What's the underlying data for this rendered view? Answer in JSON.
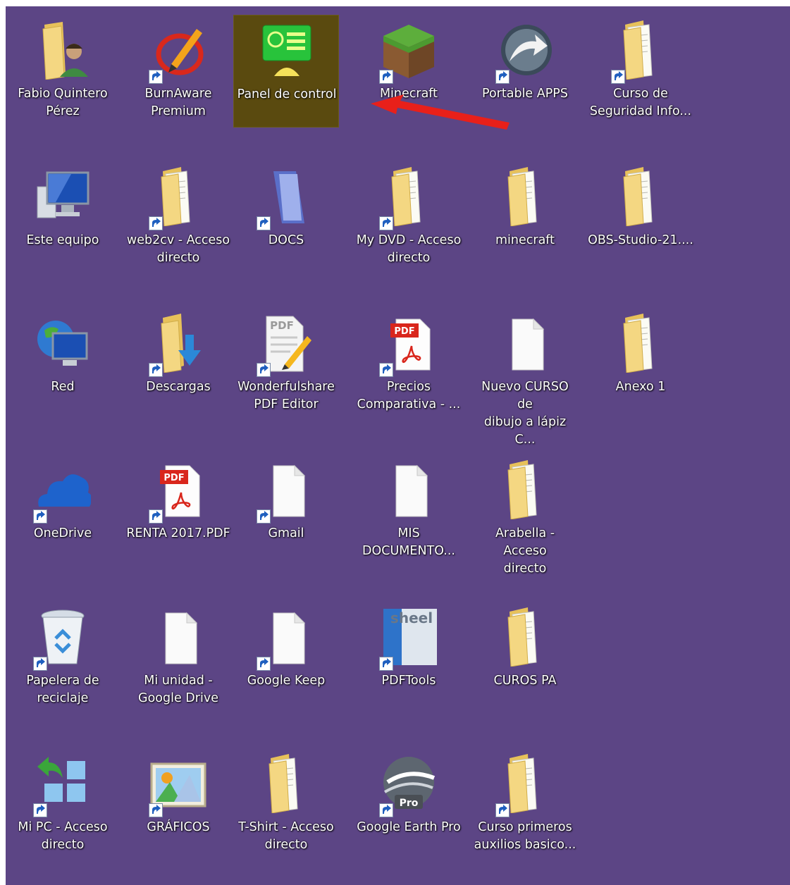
{
  "desktop": {
    "background_color": "#5c4585"
  },
  "icons": [
    {
      "label": "Fabio Quintero\nPérez",
      "icon": "user-folder-icon"
    },
    {
      "label": "BurnAware\nPremium",
      "icon": "burnaware-icon"
    },
    {
      "label": "Panel de control",
      "icon": "control-panel-icon",
      "selected": true
    },
    {
      "label": "Minecraft",
      "icon": "minecraft-block-icon"
    },
    {
      "label": "Portable APPS",
      "icon": "portableapps-icon"
    },
    {
      "label": "Curso de\nSeguridad Info...",
      "icon": "folder-icon"
    },
    {
      "label": "Este equipo",
      "icon": "computer-icon"
    },
    {
      "label": "web2cv - Acceso\ndirecto",
      "icon": "folder-icon"
    },
    {
      "label": "DOCS",
      "icon": "library-icon"
    },
    {
      "label": "My DVD - Acceso\ndirecto",
      "icon": "folder-icon"
    },
    {
      "label": "minecraft",
      "icon": "folder-icon"
    },
    {
      "label": "OBS-Studio-21....",
      "icon": "folder-icon"
    },
    {
      "label": "Red",
      "icon": "network-icon"
    },
    {
      "label": "Descargas",
      "icon": "downloads-folder-icon"
    },
    {
      "label": "Wonderfulshare\nPDF Editor",
      "icon": "pdf-editor-icon"
    },
    {
      "label": "Precios\nComparativa - ...",
      "icon": "pdf-file-icon"
    },
    {
      "label": "Nuevo CURSO de\ndibujo a lápiz C...",
      "icon": "blank-file-icon"
    },
    {
      "label": "Anexo 1",
      "icon": "folder-icon"
    },
    {
      "label": "OneDrive",
      "icon": "onedrive-cloud-icon"
    },
    {
      "label": "RENTA 2017.PDF",
      "icon": "pdf-file-icon"
    },
    {
      "label": "Gmail",
      "icon": "blank-file-icon"
    },
    {
      "label": "MIS\nDOCUMENTO...",
      "icon": "blank-file-icon"
    },
    {
      "label": "Arabella - Acceso\ndirecto",
      "icon": "folder-icon"
    },
    {
      "label": "Papelera de\nreciclaje",
      "icon": "recycle-bin-icon"
    },
    {
      "label": "Mi unidad -\nGoogle Drive",
      "icon": "blank-file-icon"
    },
    {
      "label": "Google Keep",
      "icon": "blank-file-icon"
    },
    {
      "label": "PDFTools",
      "icon": "pdftools-icon"
    },
    {
      "label": "CUROS PA",
      "icon": "folder-icon"
    },
    {
      "label": "Mi PC - Acceso\ndirecto",
      "icon": "tiles-icon"
    },
    {
      "label": "GRÁFICOS",
      "icon": "picture-icon"
    },
    {
      "label": "T-Shirt - Acceso\ndirecto",
      "icon": "folder-icon"
    },
    {
      "label": "Google Earth Pro",
      "icon": "google-earth-icon"
    },
    {
      "label": "Curso primeros\nauxilios basico...",
      "icon": "folder-icon"
    }
  ],
  "overlay_text": {
    "pdf_badge": "PDF",
    "pro_badge": "Pro",
    "pdftools_text": "sheel"
  },
  "colors": {
    "selection": "#5a4a0f",
    "arrow": "#e8201a",
    "folder": "#f2d27a",
    "pdf_red": "#d9261c"
  }
}
